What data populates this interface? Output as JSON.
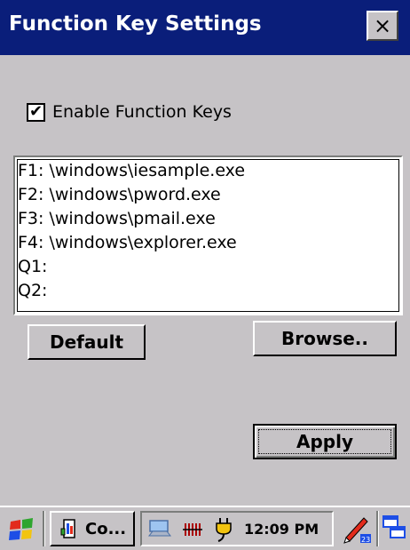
{
  "window": {
    "title": "Function Key Settings",
    "close_label": "×"
  },
  "checkbox": {
    "checked_mark": "✔",
    "label": "Enable Function Keys",
    "checked": true
  },
  "list": {
    "items": [
      "F1: \\windows\\iesample.exe",
      "F2: \\windows\\pword.exe",
      "F3: \\windows\\pmail.exe",
      "F4: \\windows\\explorer.exe",
      "Q1:",
      "Q2:"
    ]
  },
  "buttons": {
    "default_label": "Default",
    "browse_label": "Browse..",
    "apply_label": "Apply"
  },
  "taskbar": {
    "task_label": "Co...",
    "clock": "12:09 PM"
  },
  "icons": {
    "start": "windows-flag-icon",
    "task": "control-panel-icon",
    "network": "network-icon",
    "battery": "battery-icon",
    "power": "power-plug-icon",
    "input": "input-panel-icon",
    "desktop": "show-desktop-icon"
  }
}
